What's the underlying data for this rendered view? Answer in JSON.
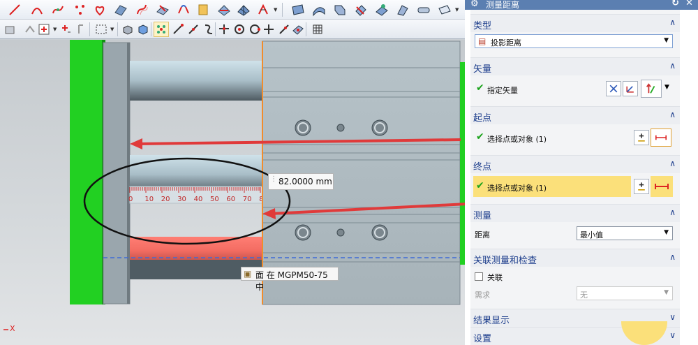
{
  "viewport": {
    "measurement_value": "82.0000 mm",
    "face_tooltip": "面 在 MGPM50-75 中",
    "ruler_ticks": [
      "0",
      "10",
      "20",
      "30",
      "40",
      "50",
      "60",
      "70",
      "80"
    ],
    "axis_label": "X"
  },
  "dialog": {
    "title": "测量距离",
    "sections": {
      "type": {
        "label": "类型",
        "selected": "投影距离"
      },
      "vector": {
        "label": "矢量",
        "row_label": "指定矢量"
      },
      "start": {
        "label": "起点",
        "row_label": "选择点或对象 (1)"
      },
      "end": {
        "label": "终点",
        "row_label": "选择点或对象 (1)"
      },
      "measure": {
        "label": "测量",
        "field_label": "距离",
        "field_value": "最小值"
      },
      "assoc": {
        "label": "关联测量和检查",
        "checkbox_label": "关联",
        "req_label": "需求",
        "req_value": "无"
      },
      "result": {
        "label": "结果显示"
      },
      "settings": {
        "label": "设置"
      }
    }
  },
  "colors": {
    "dialog_title_bar": "#5b7fb1",
    "section_header_text": "#1c3d8c",
    "highlight_row": "#fbe07a",
    "arrow_red": "#e03a3a",
    "green_plate": "#22d022",
    "check_green": "#1aa31a"
  }
}
